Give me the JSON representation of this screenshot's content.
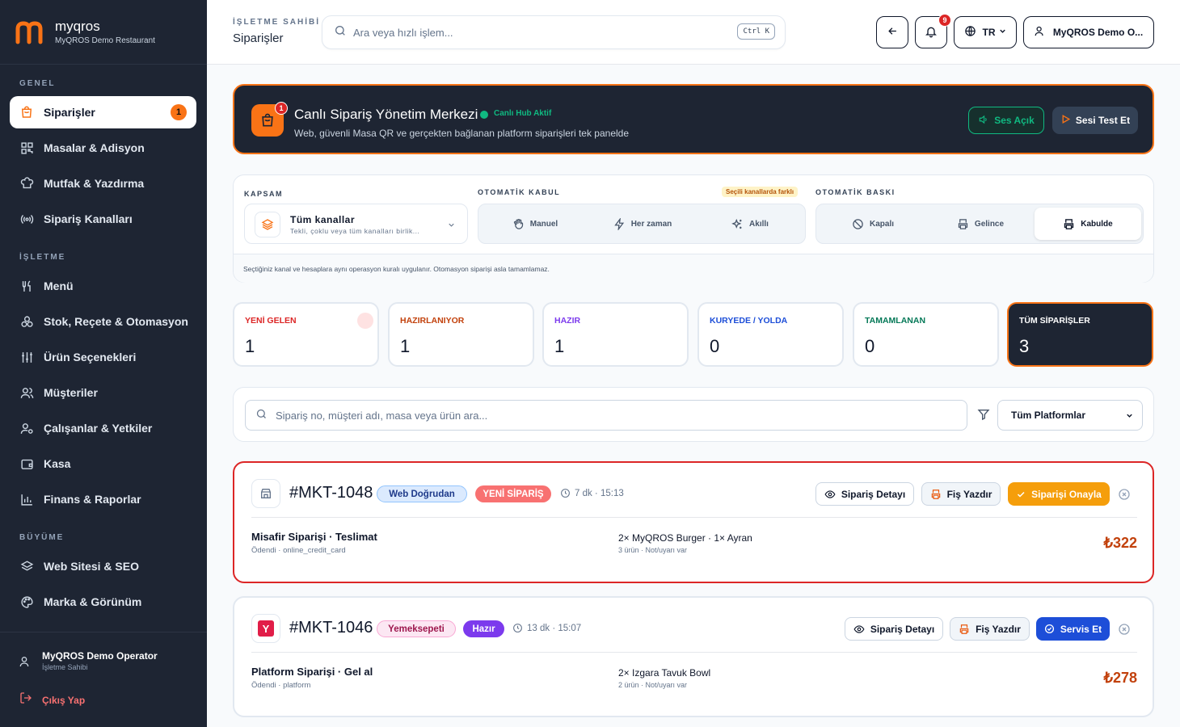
{
  "brand": {
    "name": "myqros",
    "subtitle": "MyQROS Demo Restaurant"
  },
  "sidebar": {
    "sections": [
      "GENEL",
      "İŞLETME",
      "BÜYÜME"
    ],
    "items": [
      {
        "label": "Siparişler",
        "icon": "shopping-bag-icon",
        "badge": "1"
      },
      {
        "label": "Masalar & Adisyon",
        "icon": "qr-code-icon"
      },
      {
        "label": "Mutfak & Yazdırma",
        "icon": "chef-hat-icon"
      },
      {
        "label": "Sipariş Kanalları",
        "icon": "radio-icon"
      },
      {
        "label": "Menü",
        "icon": "utensils-icon"
      },
      {
        "label": "Stok, Reçete & Otomasyon",
        "icon": "boxes-icon"
      },
      {
        "label": "Ürün Seçenekleri",
        "icon": "sliders-icon"
      },
      {
        "label": "Müşteriler",
        "icon": "users-icon"
      },
      {
        "label": "Çalışanlar & Yetkiler",
        "icon": "user-cog-icon"
      },
      {
        "label": "Kasa",
        "icon": "wallet-icon"
      },
      {
        "label": "Finans & Raporlar",
        "icon": "bar-chart-icon"
      },
      {
        "label": "Web Sitesi & SEO",
        "icon": "layers-icon"
      },
      {
        "label": "Marka & Görünüm",
        "icon": "palette-icon"
      }
    ],
    "footer": {
      "user": "MyQROS Demo Operator",
      "role": "İşletme Sahibi",
      "logout": "Çıkış Yap"
    }
  },
  "header": {
    "role": "İŞLETME SAHİBİ",
    "page": "Siparişler",
    "search_placeholder": "Ara veya hızlı işlem...",
    "shortcut": "Ctrl K",
    "notif_count": "9",
    "lang": "TR",
    "account": "MyQROS Demo O..."
  },
  "hub": {
    "title": "Canlı Sipariş Yönetim Merkezi",
    "status": "Canlı Hub Aktif",
    "subtitle": "Web, güvenli Masa QR ve gerçekten bağlanan platform siparişleri tek panelde",
    "badge": "1",
    "sound_btn": "Ses Açık",
    "test_btn": "Sesi Test Et"
  },
  "automation": {
    "scope_label": "KAPSAM",
    "scope_title": "Tüm kanallar",
    "scope_sub": "Tekli, çoklu veya tüm kanalları birlik...",
    "accept_label": "OTOMATİK KABUL",
    "accept_note": "Seçili kanallarda farklı",
    "accept_options": [
      "Manuel",
      "Her zaman",
      "Akıllı"
    ],
    "print_label": "OTOMATİK BASKI",
    "print_options": [
      "Kapalı",
      "Gelince",
      "Kabulde"
    ],
    "print_selected": "Kabulde",
    "note": "Seçtiğiniz kanal ve hesaplara aynı operasyon kuralı uygulanır. Otomasyon siparişi asla tamamlamaz."
  },
  "stats": [
    {
      "label": "YENİ GELEN",
      "value": "1",
      "color": "#dc2626"
    },
    {
      "label": "HAZIRLANIYOR",
      "value": "1",
      "color": "#c2410c"
    },
    {
      "label": "HAZIR",
      "value": "1",
      "color": "#7c3aed"
    },
    {
      "label": "KURYEDE / YOLDA",
      "value": "0",
      "color": "#1d4ed8"
    },
    {
      "label": "TAMAMLANAN",
      "value": "0",
      "color": "#047857"
    },
    {
      "label": "TÜM SİPARİŞLER",
      "value": "3",
      "color": "#ffffff"
    }
  ],
  "filter": {
    "search_placeholder": "Sipariş no, müşteri adı, masa veya ürün ara...",
    "platform": "Tüm Platformlar"
  },
  "orders": [
    {
      "id": "#MKT-1048",
      "source": "Web Doğrudan",
      "status": "YENİ SİPARİŞ",
      "time": "7 dk · 15:13",
      "detail_btn": "Sipariş Detayı",
      "print_btn": "Fiş Yazdır",
      "action_btn": "Siparişi Onayla",
      "name": "Misafir Siparişi · Teslimat",
      "payment": "Ödendi · online_credit_card",
      "items": "2× MyQROS Burger · 1× Ayran",
      "meta": "3 ürün · Not/uyarı var",
      "total": "₺322"
    },
    {
      "id": "#MKT-1046",
      "source": "Yemeksepeti",
      "status": "Hazır",
      "time": "13 dk · 15:07",
      "detail_btn": "Sipariş Detayı",
      "print_btn": "Fiş Yazdır",
      "action_btn": "Servis Et",
      "name": "Platform Siparişi · Gel al",
      "payment": "Ödendi · platform",
      "items": "2× Izgara Tavuk Bowl",
      "meta": "2 ürün · Not/uyarı var",
      "total": "₺278"
    }
  ]
}
